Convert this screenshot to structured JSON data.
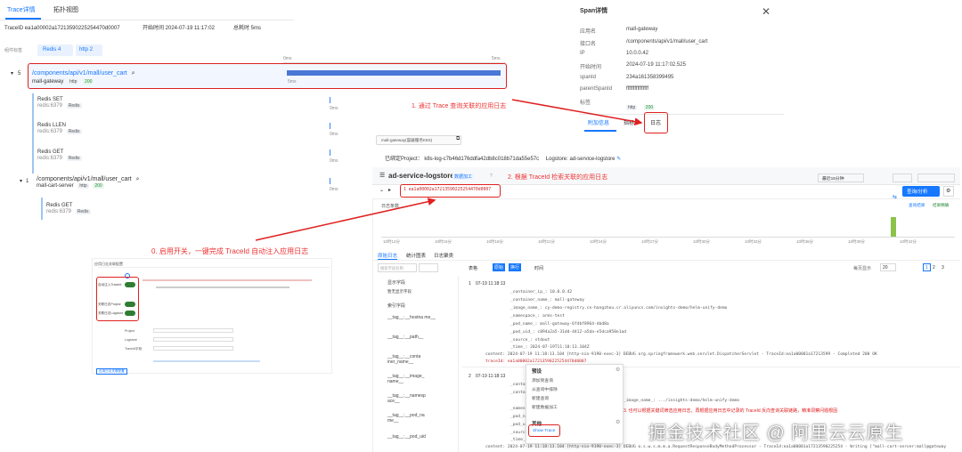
{
  "colors": {
    "accent": "#1677ff",
    "annotation": "#e02020",
    "span_bar": "#4a78d6",
    "histogram": "#8bc34a"
  },
  "trace_panel": {
    "tabs": [
      "Trace详情",
      "拓扑视图"
    ],
    "trace_id": "TraceID ea1a00002a17213590225254470d0007",
    "start_time": "开始时间 2024-07-19 11:17:02",
    "duration": "总耗时 5ms",
    "filter_label": "组件标签",
    "filters": [
      "Redis 4",
      "http 2"
    ],
    "scale_start": "0ms",
    "scale_end": "5ms",
    "root_span": {
      "count": "5",
      "path": "/components/api/v1/mall/user_cart",
      "service": "mall-gateway",
      "badges": [
        "http",
        "200"
      ],
      "duration": "5ms"
    },
    "redis_spans": [
      {
        "title": "Redis  SET",
        "host": "redis:6379",
        "badge": "Redis",
        "duration": "0ms"
      },
      {
        "title": "Redis  LLEN",
        "host": "redis:6379",
        "badge": "Redis",
        "duration": "0ms"
      },
      {
        "title": "Redis  GET",
        "host": "redis:6379",
        "badge": "Redis",
        "duration": "0ms"
      }
    ],
    "child_span": {
      "count": "1",
      "path": "/components/api/v1/mall/user_cart",
      "service": "mall-cart-server",
      "badges": [
        "http",
        "200"
      ],
      "duration": "0ms"
    },
    "child_redis": {
      "title": "Redis  GET",
      "host": "redis:6379",
      "badge": "Redis"
    }
  },
  "span_detail": {
    "title": "Span详情",
    "fields": [
      {
        "k": "应用名",
        "v": "mall-gateway"
      },
      {
        "k": "接口名",
        "v": "/components/api/v1/mall/user_cart"
      },
      {
        "k": "IP",
        "v": "10.0.0.42"
      },
      {
        "k": "开始时间",
        "v": "2024-07-19 11:17:02.525"
      },
      {
        "k": "spanId",
        "v": "234a161358399495"
      },
      {
        "k": "parentSpanId",
        "v": "ffffffffffffffff"
      },
      {
        "k": "标签",
        "v": ""
      }
    ],
    "tags": [
      "http",
      "200"
    ],
    "tabs": [
      "附加信息",
      "指标",
      "日志"
    ]
  },
  "annotations": {
    "a0": "0. 启用开关，一键完成 TraceId 自动注入应用日志",
    "a1": "1. 通过 Trace 查询关联的应用日志",
    "a2": "2. 根据 TraceId 检索关联的应用日志",
    "a3": "3. 也可以根据关键词筛选应用日志，再根据应用日志中记录的 TraceId 反向查询关联链路，精准洞察问题根因"
  },
  "log_panel": {
    "service_select": "mall-gateway(容器服务K8S)",
    "bound_project": "已绑定Project： k8s-log-c7b46d176ddfa42db8c018b71da55e57c",
    "logstore": "Logstore: ad-service-logstore",
    "store_name": "ad-service-logstore",
    "store_tags": [
      "数据加工",
      "?"
    ],
    "query": "1  ea1a00002a17213590225254470d0007",
    "time_range": "最近15分钟",
    "query_btn": "查询/分析",
    "histogram_label": "日志条数",
    "hist_link1": "查询结果",
    "hist_link2": "结果精确",
    "hist_axis": [
      "10时12分",
      "10时15分",
      "10时18分",
      "10时21分",
      "10时24分",
      "10时27分",
      "10时30分",
      "10时33分",
      "10时36分",
      "10时39分",
      "10时42分"
    ],
    "subtabs": [
      "原始日志",
      "统计图表",
      "日志聚类"
    ],
    "toolbar": [
      "表格",
      "原始",
      "换行",
      "时间"
    ],
    "paging": {
      "per_page": "20",
      "total_label": "每页显示",
      "pages": [
        "1",
        "2",
        "3"
      ]
    },
    "field_search": "搜索字段名称",
    "field_groups": [
      "显示字段",
      "暂无显示字段",
      "索引字段"
    ],
    "fields": [
      "__tag__:__hostna me__",
      "__tag__:__path__",
      "__tag__:__conta iner_name__",
      "__tag__:__image_ name__",
      "__tag__:__namesp ace__",
      "__tag__:__pod_na me__",
      "__tag__:__pod_uid"
    ],
    "entry1": {
      "index": "1",
      "time": "07-19 11:18:13",
      "lines": [
        "_container_ip_: 10.0.0.42",
        "_container_name_: mall-gateway",
        "_image_name_: cy-demo-registry.cn-hangzhou.cr.aliyuncs.com/insights-demo/helm-unify-demo",
        "_namespace_: arms-test",
        "_pod_name_: mall-gateway-6f4bf8964-dbd8a",
        "_pod_uid_: c894a2a5-31dd-4412-a5da-e5dca958e1ad",
        "_source_: stdout",
        "_time_: 2024-07-19T11:18:13.104Z",
        "content: 2024-07-19 11:18:13.104 [http-nio-9190-exec-3] DEBUG org.springframework.web.servlet.DispatcherServlet - TraceId:ea1a00001a17213599 - Completed 200 OK",
        "traceId: ea1a00002a17213590225254470d0007"
      ]
    },
    "entry2": {
      "index": "2",
      "time": "07-19 11:18:13",
      "lines": [
        "_container_ip_",
        "_container_name_",
        "_image_name_: .../insights-demo/helm-unify-demo",
        "_namespace_",
        "_pod_name_",
        "_pod_uid_",
        "_source_",
        "_time_",
        "content: 2024-07-19 11:18:13.104 [http-nio-9190-exec-3] DEBUG o.s.w.s.m.m.a.RequestResponseBodyMethodProcessor - TraceId:ea1a00001a17213590225254 - Writing [\"mall-cart-server:mall@gateway"
      ]
    },
    "context_menu": {
      "group1": "预设",
      "items1": [
        "添加到查询",
        "从查询中排除",
        "新建查询",
        "新建数据加工"
      ],
      "group2": "其他",
      "items2": [
        "Show Trace"
      ]
    },
    "watermark": "掘金技术社区 @ 阿里云云原生"
  },
  "switch_panel": {
    "title": "应用日志关联配置",
    "rows": [
      "自动注入TraceId",
      "关联日志Project",
      "关联日志Logstore"
    ],
    "fields": [
      "Project",
      "Logstore",
      "TraceId字段"
    ],
    "link": "应用日志关联配置"
  }
}
